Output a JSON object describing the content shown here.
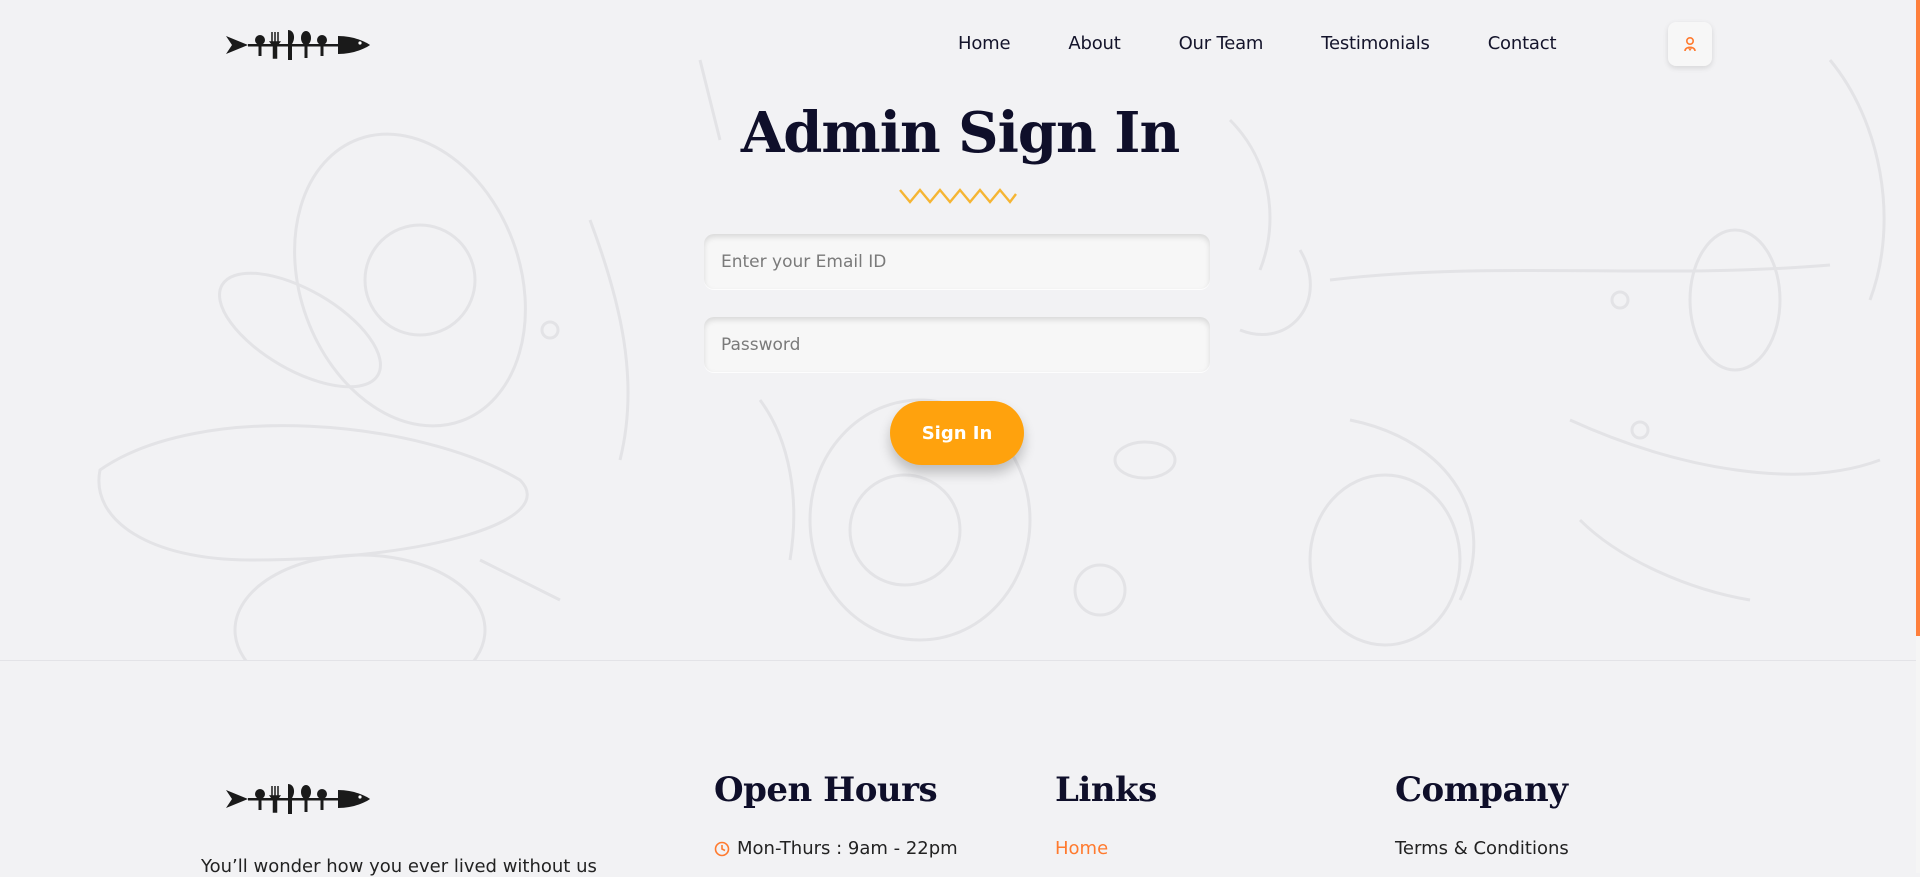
{
  "header": {
    "logo_name": "cutlery-fish-logo",
    "nav": [
      {
        "label": "Home"
      },
      {
        "label": "About"
      },
      {
        "label": "Our Team"
      },
      {
        "label": "Testimonials"
      },
      {
        "label": "Contact"
      }
    ],
    "user_icon": "chef-icon"
  },
  "main": {
    "title": "Admin Sign In",
    "email_placeholder": "Enter your Email ID",
    "password_placeholder": "Password",
    "signin_label": "Sign In"
  },
  "footer": {
    "tagline": "You’ll wonder how you ever lived without us",
    "open_hours": {
      "title": "Open Hours",
      "lines": [
        "Mon-Thurs : 9am - 22pm"
      ]
    },
    "links": {
      "title": "Links",
      "items": [
        "Home"
      ]
    },
    "company": {
      "title": "Company",
      "items": [
        "Terms & Conditions"
      ]
    }
  },
  "colors": {
    "accent": "#ffa20d",
    "link_active": "#ff7a2e",
    "background": "#f2f2f4",
    "scroll_thumb": "#ff7f3b"
  }
}
